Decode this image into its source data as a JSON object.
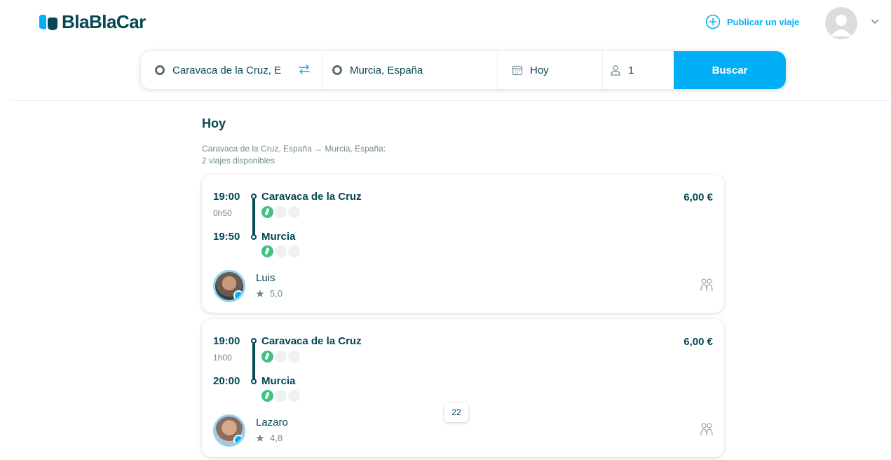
{
  "header": {
    "brand": "BlaBlaCar",
    "publish_label": "Publicar un viaje"
  },
  "search": {
    "from": "Caravaca de la Cruz, E",
    "to": "Murcia, España",
    "date": "Hoy",
    "passengers": "1",
    "button_label": "Buscar"
  },
  "results": {
    "day_title": "Hoy",
    "route_line": "Caravaca de la Cruz, España → Murcia, España:",
    "count_line": "2 viajes disponibles",
    "trips": [
      {
        "depart_time": "19:00",
        "duration": "0h50",
        "arrive_time": "19:50",
        "from_place": "Caravaca de la Cruz",
        "to_place": "Murcia",
        "price": "6,00 €",
        "driver": "Luis",
        "rating": "5,0"
      },
      {
        "depart_time": "19:00",
        "duration": "1h00",
        "arrive_time": "20:00",
        "from_place": "Caravaca de la Cruz",
        "to_place": "Murcia",
        "price": "6,00 €",
        "driver": "Lazaro",
        "rating": "4,8"
      }
    ]
  },
  "overlay": {
    "page_indicator": "22"
  },
  "colors": {
    "brand_blue": "#00aff5",
    "text_dark": "#054752",
    "text_muted": "#708c91",
    "amenity_green": "#3fc27d"
  }
}
